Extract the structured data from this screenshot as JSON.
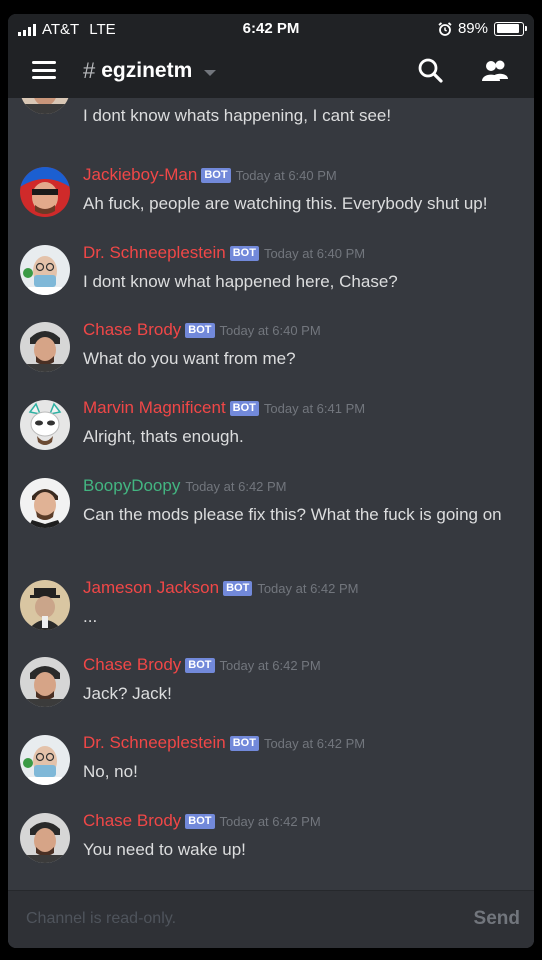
{
  "status": {
    "carrier": "AT&T",
    "network": "LTE",
    "time": "6:42 PM",
    "battery": "89%",
    "battery_level": 0.89,
    "icons": [
      "signal-icon",
      "alarm-icon",
      "battery-icon"
    ]
  },
  "header": {
    "hash": "#",
    "channel": "egzinetm"
  },
  "messages": [
    {
      "avatar": "beanie-man",
      "name": "",
      "bot": false,
      "time": "",
      "text": "I dont know whats happening, I cant see!"
    },
    {
      "avatar": "jackieboy",
      "name": "Jackieboy-Man",
      "bot": true,
      "time": "Today at 6:40 PM",
      "text": "Ah fuck, people are watching this. Everybody shut up!"
    },
    {
      "avatar": "schneeplestein",
      "name": "Dr. Schneeplestein",
      "bot": true,
      "time": "Today at 6:40 PM",
      "text": "I dont know what happened here, Chase?"
    },
    {
      "avatar": "chase",
      "name": "Chase Brody",
      "bot": true,
      "time": "Today at 6:40 PM",
      "text": "What do you want from me?"
    },
    {
      "avatar": "marvin",
      "name": "Marvin Magnificent",
      "bot": true,
      "time": "Today at 6:41 PM",
      "text": "Alright, thats enough."
    },
    {
      "avatar": "boopy",
      "name": "BoopyDoopy",
      "bot": false,
      "time": "Today at 6:42 PM",
      "text": "Can the mods please fix this? What the fuck is going on"
    },
    {
      "avatar": "jameson",
      "name": "Jameson Jackson",
      "bot": true,
      "time": "Today at 6:42 PM",
      "text": "..."
    },
    {
      "avatar": "chase",
      "name": "Chase Brody",
      "bot": true,
      "time": "Today at 6:42 PM",
      "text": "Jack? Jack!"
    },
    {
      "avatar": "schneeplestein",
      "name": "Dr. Schneeplestein",
      "bot": true,
      "time": "Today at 6:42 PM",
      "text": "No, no!"
    },
    {
      "avatar": "chase",
      "name": "Chase Brody",
      "bot": true,
      "time": "Today at 6:42 PM",
      "text": "You need to wake up!"
    }
  ],
  "bot_label": "BOT",
  "input": {
    "placeholder": "Channel is read-only.",
    "send": "Send"
  },
  "colors": {
    "background": "#36393f",
    "header": "#202225",
    "bot_name": "#f04747",
    "user_name": "#43b581",
    "bot_tag": "#7289da"
  }
}
